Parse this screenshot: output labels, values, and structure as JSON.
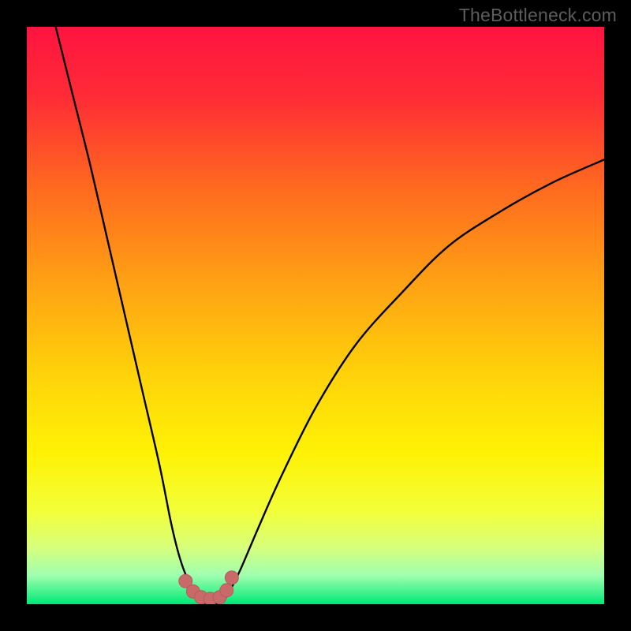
{
  "watermark": "TheBottleneck.com",
  "colors": {
    "gradient_stops": [
      {
        "offset": 0.0,
        "color": "#ff1440"
      },
      {
        "offset": 0.12,
        "color": "#ff2b36"
      },
      {
        "offset": 0.28,
        "color": "#ff6a1f"
      },
      {
        "offset": 0.44,
        "color": "#ffa014"
      },
      {
        "offset": 0.6,
        "color": "#ffd20a"
      },
      {
        "offset": 0.74,
        "color": "#fff205"
      },
      {
        "offset": 0.84,
        "color": "#f2ff3a"
      },
      {
        "offset": 0.9,
        "color": "#d8ff7a"
      },
      {
        "offset": 0.95,
        "color": "#a0ffb0"
      },
      {
        "offset": 1.0,
        "color": "#00e874"
      }
    ],
    "curve": "#000000",
    "marker_fill": "#c86a6a",
    "marker_stroke": "#b85a58",
    "frame": "#000000"
  },
  "chart_data": {
    "type": "line",
    "title": "",
    "xlabel": "",
    "ylabel": "",
    "xlim": [
      0,
      100
    ],
    "ylim": [
      0,
      100
    ],
    "left_branch": {
      "x": [
        5,
        8,
        11,
        14,
        17,
        20,
        23,
        25,
        26.5,
        28,
        29.5,
        30
      ],
      "y": [
        100,
        88,
        76,
        63,
        50,
        37,
        24,
        14,
        8,
        4,
        1.5,
        0.5
      ]
    },
    "right_branch": {
      "x": [
        34,
        35,
        37,
        40,
        44,
        50,
        57,
        65,
        73,
        82,
        91,
        100
      ],
      "y": [
        0.5,
        2,
        6,
        13,
        22,
        34,
        45,
        54,
        62,
        68,
        73,
        77
      ]
    },
    "bottom_bridge": {
      "x": [
        30,
        31.5,
        33,
        34
      ],
      "y": [
        0.5,
        0,
        0,
        0.5
      ]
    },
    "markers": [
      {
        "x": 27.5,
        "y": 4.0
      },
      {
        "x": 28.8,
        "y": 2.2
      },
      {
        "x": 30.2,
        "y": 1.2
      },
      {
        "x": 31.8,
        "y": 0.9
      },
      {
        "x": 33.4,
        "y": 1.2
      },
      {
        "x": 34.6,
        "y": 2.4
      },
      {
        "x": 35.5,
        "y": 4.6
      }
    ]
  }
}
